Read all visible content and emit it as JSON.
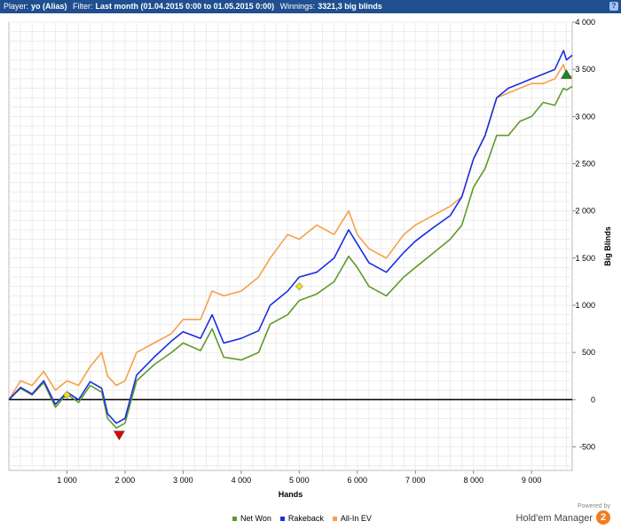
{
  "header": {
    "player_label": "Player:",
    "player_value": "yo (Alias)",
    "filter_label": "Filter:",
    "filter_value": "Last month (01.04.2015 0:00 to 01.05.2015 0:00)",
    "winnings_label": "Winnings:",
    "winnings_value": "3321,3 big blinds",
    "help_icon": "question-icon",
    "bar_color": "#1f4f8f"
  },
  "branding": {
    "powered_by": "Powered by",
    "name": "Hold'em Manager",
    "logo_text": "2",
    "logo_color": "#f07d22"
  },
  "chart_data": {
    "type": "line",
    "xlabel": "Hands",
    "ylabel": "Big Blinds",
    "xlim": [
      0,
      9700
    ],
    "ylim": [
      -750,
      4000
    ],
    "x_ticks": [
      1000,
      2000,
      3000,
      4000,
      5000,
      6000,
      7000,
      8000,
      9000
    ],
    "x_tick_labels": [
      "1 000",
      "2 000",
      "3 000",
      "4 000",
      "5 000",
      "6 000",
      "7 000",
      "8 000",
      "9 000"
    ],
    "y_ticks": [
      -500,
      0,
      500,
      1000,
      1500,
      2000,
      2500,
      3000,
      3500,
      4000
    ],
    "y_tick_labels": [
      "-500",
      "0",
      "500",
      "1 000",
      "1 500",
      "2 000",
      "2 500",
      "3 000",
      "3 500",
      "4 000"
    ],
    "grid": true,
    "zero_line": true,
    "legend_position": "bottom",
    "x": [
      0,
      200,
      400,
      600,
      800,
      1000,
      1200,
      1400,
      1600,
      1700,
      1850,
      2000,
      2200,
      2500,
      2800,
      3000,
      3300,
      3500,
      3700,
      4000,
      4300,
      4500,
      4800,
      5000,
      5300,
      5600,
      5850,
      6000,
      6200,
      6500,
      6800,
      7000,
      7300,
      7600,
      7800,
      8000,
      8200,
      8400,
      8600,
      8800,
      9000,
      9200,
      9400,
      9550,
      9600,
      9700
    ],
    "series": [
      {
        "name": "Net Won",
        "color": "#5f9a2a",
        "values": [
          0,
          120,
          50,
          180,
          -80,
          60,
          -30,
          150,
          80,
          -200,
          -300,
          -250,
          200,
          370,
          500,
          600,
          520,
          750,
          450,
          420,
          500,
          800,
          900,
          1050,
          1120,
          1250,
          1520,
          1400,
          1200,
          1100,
          1300,
          1400,
          1550,
          1700,
          1850,
          2250,
          2450,
          2800,
          2800,
          2950,
          3000,
          3150,
          3120,
          3300,
          3280,
          3320
        ]
      },
      {
        "name": "Rakeback",
        "color": "#1a2fe0",
        "values": [
          0,
          130,
          60,
          200,
          -50,
          80,
          0,
          190,
          120,
          -150,
          -250,
          -200,
          260,
          450,
          620,
          720,
          650,
          900,
          600,
          650,
          730,
          1000,
          1150,
          1300,
          1350,
          1500,
          1800,
          1650,
          1450,
          1350,
          1560,
          1680,
          1820,
          1950,
          2150,
          2550,
          2800,
          3200,
          3300,
          3350,
          3400,
          3450,
          3500,
          3700,
          3600,
          3650
        ]
      },
      {
        "name": "All-In EV",
        "color": "#f5a04a",
        "values": [
          0,
          200,
          150,
          300,
          100,
          200,
          150,
          350,
          500,
          250,
          150,
          200,
          500,
          600,
          700,
          850,
          850,
          1150,
          1100,
          1150,
          1300,
          1500,
          1750,
          1700,
          1850,
          1750,
          2000,
          1750,
          1600,
          1500,
          1750,
          1850,
          1950,
          2050,
          2150,
          2550,
          2800,
          3200,
          3250,
          3300,
          3350,
          3350,
          3400,
          3550,
          3450,
          3420
        ]
      }
    ],
    "markers": [
      {
        "type": "triangle-down",
        "x": 1900,
        "y": -380,
        "color": "#e00000"
      },
      {
        "type": "triangle-up",
        "x": 9600,
        "y": 3450,
        "color": "#1a8a20"
      },
      {
        "type": "diamond",
        "x": 1000,
        "y": 50,
        "color": "#f0e020"
      },
      {
        "type": "diamond",
        "x": 5000,
        "y": 1200,
        "color": "#f0e020"
      }
    ]
  }
}
